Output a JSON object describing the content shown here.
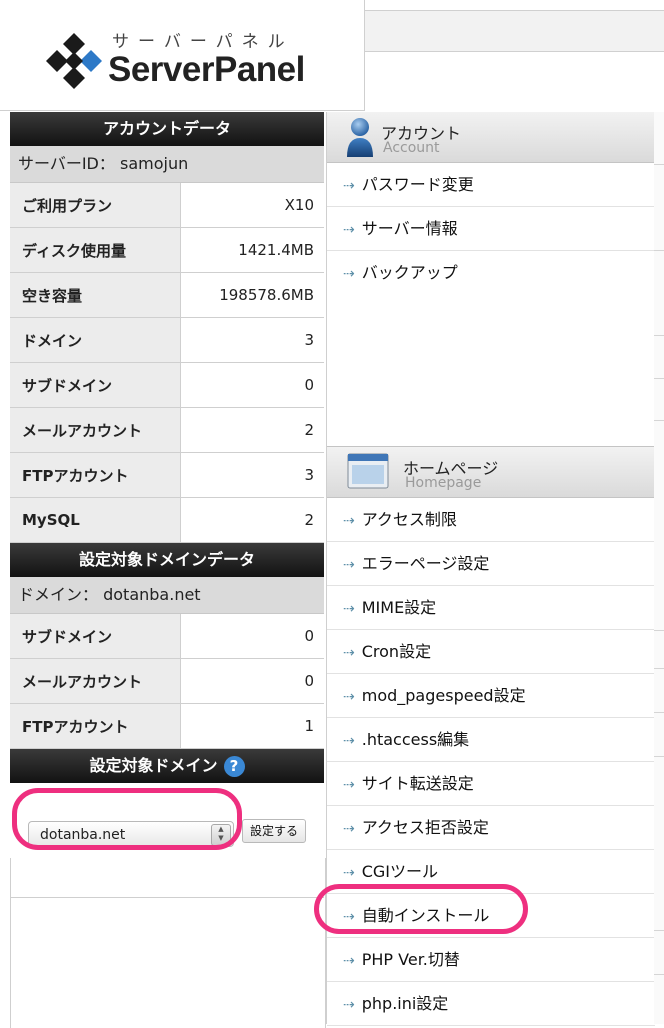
{
  "header": {
    "logo_kana": "サーバーパネル",
    "logo_name": "ServerPanel"
  },
  "account_data": {
    "title": "アカウントデータ",
    "server_id_label": "サーバーID：",
    "server_id_value": "samojun",
    "rows": [
      {
        "label": "ご利用プラン",
        "value": "X10"
      },
      {
        "label": "ディスク使用量",
        "value": "1421.4MB"
      },
      {
        "label": "空き容量",
        "value": "198578.6MB"
      },
      {
        "label": "ドメイン",
        "value": "3"
      },
      {
        "label": "サブドメイン",
        "value": "0"
      },
      {
        "label": "メールアカウント",
        "value": "2"
      },
      {
        "label": "FTPアカウント",
        "value": "3"
      },
      {
        "label": "MySQL",
        "value": "2"
      }
    ]
  },
  "domain_data": {
    "title": "設定対象ドメインデータ",
    "domain_label": "ドメイン：",
    "domain_value": "dotanba.net",
    "rows": [
      {
        "label": "サブドメイン",
        "value": "0"
      },
      {
        "label": "メールアカウント",
        "value": "0"
      },
      {
        "label": "FTPアカウント",
        "value": "1"
      }
    ]
  },
  "domain_select": {
    "title": "設定対象ドメイン",
    "help": "?",
    "selected": "dotanba.net",
    "button": "設定する"
  },
  "account_panel": {
    "title": "アカウント",
    "subtitle": "Account",
    "items": [
      "パスワード変更",
      "サーバー情報",
      "バックアップ"
    ]
  },
  "homepage_panel": {
    "title": "ホームページ",
    "subtitle": "Homepage",
    "items": [
      "アクセス制限",
      "エラーページ設定",
      "MIME設定",
      "Cron設定",
      "mod_pagespeed設定",
      ".htaccess編集",
      "サイト転送設定",
      "アクセス拒否設定",
      "CGIツール",
      "自動インストール",
      "PHP Ver.切替",
      "php.ini設定"
    ]
  },
  "colors": {
    "highlight": "#ee2f7f",
    "header_dark": "#121212",
    "help_blue": "#3a88d5",
    "arrow": "#5d8fa8"
  }
}
